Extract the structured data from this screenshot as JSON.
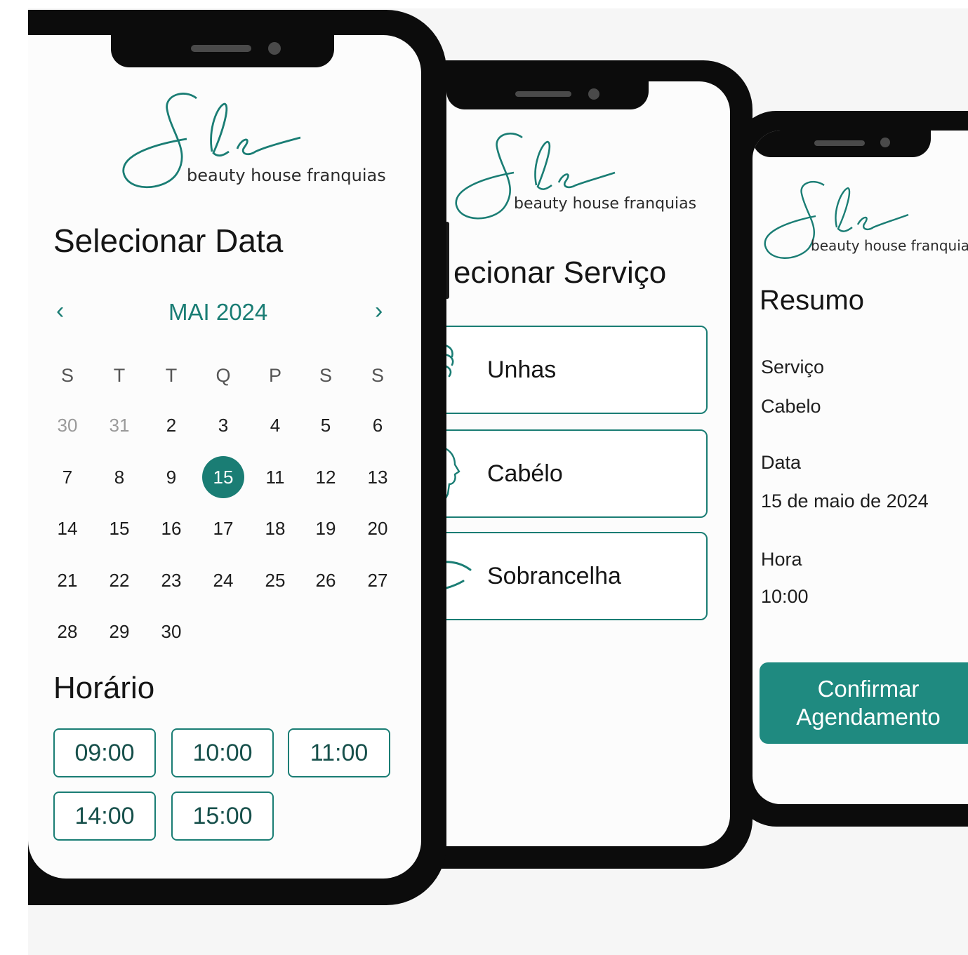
{
  "brand": {
    "logo_text": "beauty house franquias",
    "accent_color": "#1a7d74",
    "button_color": "#1f8a80"
  },
  "screen_date": {
    "title": "Selecionar Data",
    "prev_icon": "chevron-left-icon",
    "next_icon": "chevron-right-icon",
    "month": "MAI 2024",
    "weekdays": [
      "S",
      "T",
      "T",
      "Q",
      "P",
      "S",
      "S"
    ],
    "weeks": [
      [
        "30",
        "31",
        "2",
        "3",
        "4",
        "5",
        "6"
      ],
      [
        "7",
        "8",
        "9",
        "15",
        "11",
        "12",
        "13"
      ],
      [
        "14",
        "15",
        "16",
        "17",
        "18",
        "19",
        "20"
      ],
      [
        "21",
        "22",
        "23",
        "24",
        "25",
        "26",
        "27"
      ],
      [
        "28",
        "29",
        "30"
      ]
    ],
    "selected_day": "15",
    "time_title": "Horário",
    "times": [
      "09:00",
      "10:00",
      "11:00",
      "14:00",
      "15:00"
    ]
  },
  "screen_service": {
    "title": "ecionar Serviço",
    "services": [
      {
        "label": "Unhas",
        "icon": "hand-icon"
      },
      {
        "label": "Cabélo",
        "icon": "face-profile-icon"
      },
      {
        "label": "Sobrancelha",
        "icon": "eye-icon"
      }
    ]
  },
  "screen_summary": {
    "title": "Resumo",
    "service_label": "Serviço",
    "service_value": "Cabelo",
    "date_label": "Data",
    "date_value": "15 de maio de 2024",
    "time_label": "Hora",
    "time_value": "10:00",
    "confirm_line1": "Confirmar",
    "confirm_line2": "Agendamento"
  }
}
